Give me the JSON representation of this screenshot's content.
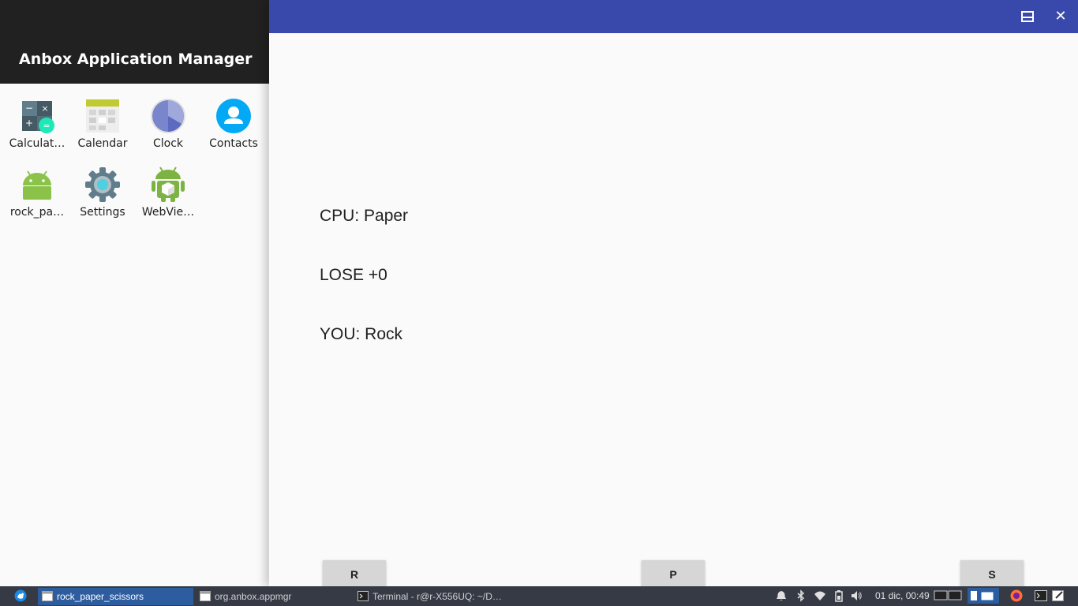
{
  "appmgr": {
    "title": "Anbox Application Manager",
    "apps": [
      {
        "label": "Calculat…",
        "icon": "calculator-icon"
      },
      {
        "label": "Calendar",
        "icon": "calendar-icon"
      },
      {
        "label": "Clock",
        "icon": "clock-icon"
      },
      {
        "label": "Contacts",
        "icon": "contacts-icon"
      },
      {
        "label": "rock_pa…",
        "icon": "android-icon"
      },
      {
        "label": "Settings",
        "icon": "settings-gear-icon"
      },
      {
        "label": "WebVie…",
        "icon": "android-webview-icon"
      }
    ]
  },
  "game": {
    "cpu_text": "CPU: Paper",
    "result_text": "LOSE +0",
    "you_text": "YOU: Rock",
    "buttons": {
      "rock": "R",
      "paper": "P",
      "scissors": "S"
    }
  },
  "window": {
    "maximize_symbol": "▭",
    "close_symbol": "✕"
  },
  "taskbar": {
    "tasks": [
      {
        "label": "rock_paper_scissors",
        "active": true
      },
      {
        "label": "org.anbox.appmgr",
        "active": false
      },
      {
        "label": "Terminal - r@r-X556UQ: ~/D…",
        "active": false
      }
    ],
    "clock": "01 dic, 00:49"
  },
  "colors": {
    "titlebar": "#3949ab",
    "appmgr_header": "#212121",
    "taskbar": "#353a45",
    "active_task": "#2d5d9f"
  }
}
